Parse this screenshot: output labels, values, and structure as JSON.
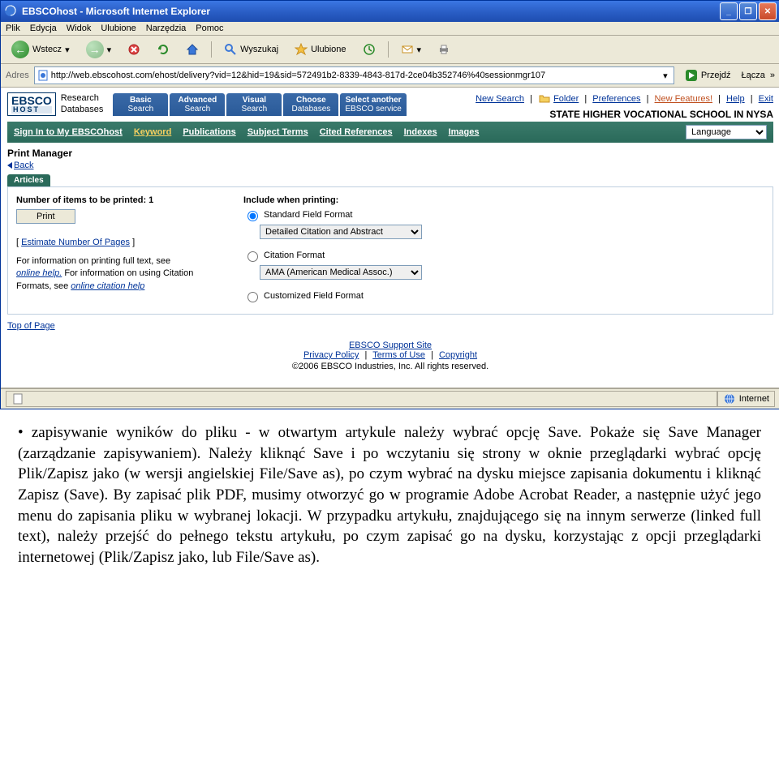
{
  "titlebar": {
    "title": "EBSCOhost - Microsoft Internet Explorer"
  },
  "menubar": {
    "items": [
      "Plik",
      "Edycja",
      "Widok",
      "Ulubione",
      "Narzędzia",
      "Pomoc"
    ]
  },
  "toolbar": {
    "back": "Wstecz",
    "search": "Wyszukaj",
    "favorites": "Ulubione"
  },
  "addressbar": {
    "label": "Adres",
    "url": "http://web.ebscohost.com/ehost/delivery?vid=12&hid=19&sid=572491b2-8339-4843-817d-2ce04b352746%40sessionmgr107",
    "go": "Przejdź",
    "links": "Łącza"
  },
  "ebsco": {
    "logo_top": "EBSCO",
    "logo_bottom": "HOST",
    "logo_desc1": "Research",
    "logo_desc2": "Databases"
  },
  "nav_tabs": [
    {
      "l1": "Basic",
      "l2": "Search"
    },
    {
      "l1": "Advanced",
      "l2": "Search"
    },
    {
      "l1": "Visual",
      "l2": "Search"
    },
    {
      "l1": "Choose",
      "l2": "Databases"
    },
    {
      "l1": "Select another",
      "l2": "EBSCO service"
    }
  ],
  "header_links": {
    "new_search": "New Search",
    "folder": "Folder",
    "preferences": "Preferences",
    "new_features": "New Features!",
    "help": "Help",
    "exit": "Exit"
  },
  "org_name": "STATE HIGHER VOCATIONAL SCHOOL IN NYSA",
  "subnav": {
    "signin": "Sign In to My EBSCOhost",
    "keyword": "Keyword",
    "pubs": "Publications",
    "subj": "Subject Terms",
    "cited": "Cited References",
    "idx": "Indexes",
    "img": "Images",
    "lang": "Language"
  },
  "pm": {
    "title": "Print Manager",
    "back": "Back",
    "tab": "Articles"
  },
  "col1": {
    "num_label": "Number of items to be printed: 1",
    "print": "Print",
    "est": "Estimate Number Of Pages",
    "help1": "For information on printing full text, see ",
    "help1_link": "online help.",
    "help2": "  For information on using Citation Formats, see ",
    "help2_link": "online citation help"
  },
  "col2": {
    "include": "Include when printing:",
    "opt1": "Standard Field Format",
    "sel1": "Detailed Citation and Abstract",
    "opt2": "Citation Format",
    "sel2": "AMA (American Medical Assoc.)",
    "opt3": "Customized Field Format"
  },
  "top_of_page": "Top of Page",
  "footer": {
    "support": "EBSCO Support Site",
    "privacy": "Privacy Policy",
    "terms": "Terms of Use",
    "copyright": "Copyright",
    "copy_text": "©2006 EBSCO Industries, Inc. All rights reserved."
  },
  "status": {
    "zone": "Internet"
  },
  "below_text": "• zapisywanie wyników do pliku - w otwartym artykule należy wybrać opcję Save. Pokaże się Save Manager (zarządzanie zapisywaniem). Należy kliknąć Save i po wczytaniu się strony w oknie przeglądarki wybrać opcję Plik/Zapisz jako (w wersji angielskiej File/Save as), po czym wybrać na dysku miejsce zapisania dokumentu i kliknąć Zapisz (Save). By zapisać plik PDF, musimy otworzyć go w programie Adobe Acrobat Reader, a następnie użyć jego menu do zapisania pliku w wybranej lokacji. W przypadku artykułu, znajdującego się na innym serwerze (linked full text), należy przejść do pełnego tekstu artykułu, po czym zapisać go na dysku, korzystając z opcji przeglądarki internetowej (Plik/Zapisz jako, lub File/Save as)."
}
